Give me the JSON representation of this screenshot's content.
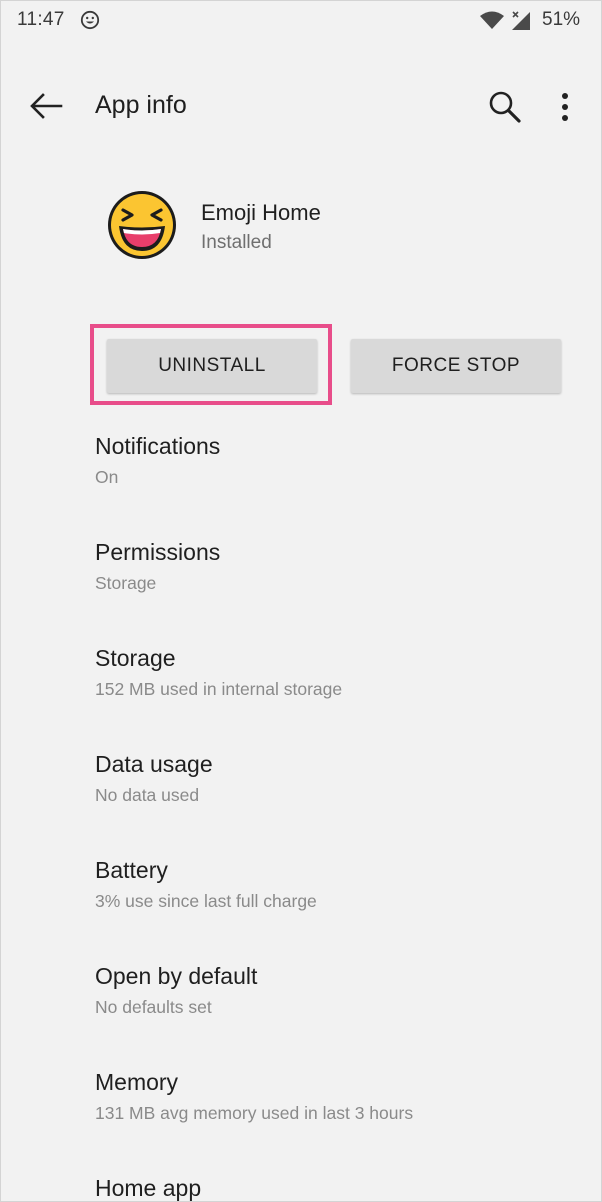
{
  "status_bar": {
    "time": "11:47",
    "battery_percent": "51%",
    "icons": [
      "emoji-notification-icon",
      "wifi-icon",
      "signal-icon"
    ]
  },
  "app_bar": {
    "title": "App info",
    "icons": [
      "back-arrow-icon",
      "search-icon",
      "more-vert-icon"
    ]
  },
  "app": {
    "name": "Emoji Home",
    "status": "Installed",
    "icon": "laughing-emoji-icon"
  },
  "buttons": {
    "uninstall": "UNINSTALL",
    "force_stop": "FORCE STOP"
  },
  "colors": {
    "background": "#f2f2f2",
    "button": "#d9d9d9",
    "highlight": "#e84d8a",
    "title_text": "#1f1f1f",
    "summary_text": "#8a8a8a"
  },
  "settings": [
    {
      "id": "notifications",
      "title": "Notifications",
      "summary": "On"
    },
    {
      "id": "permissions",
      "title": "Permissions",
      "summary": "Storage"
    },
    {
      "id": "storage",
      "title": "Storage",
      "summary": "152 MB used in internal storage"
    },
    {
      "id": "data-usage",
      "title": "Data usage",
      "summary": "No data used"
    },
    {
      "id": "battery",
      "title": "Battery",
      "summary": "3% use since last full charge"
    },
    {
      "id": "open-by-default",
      "title": "Open by default",
      "summary": "No defaults set"
    },
    {
      "id": "memory",
      "title": "Memory",
      "summary": "131 MB avg memory used in last 3 hours"
    },
    {
      "id": "home-app",
      "title": "Home app",
      "summary": ""
    }
  ]
}
